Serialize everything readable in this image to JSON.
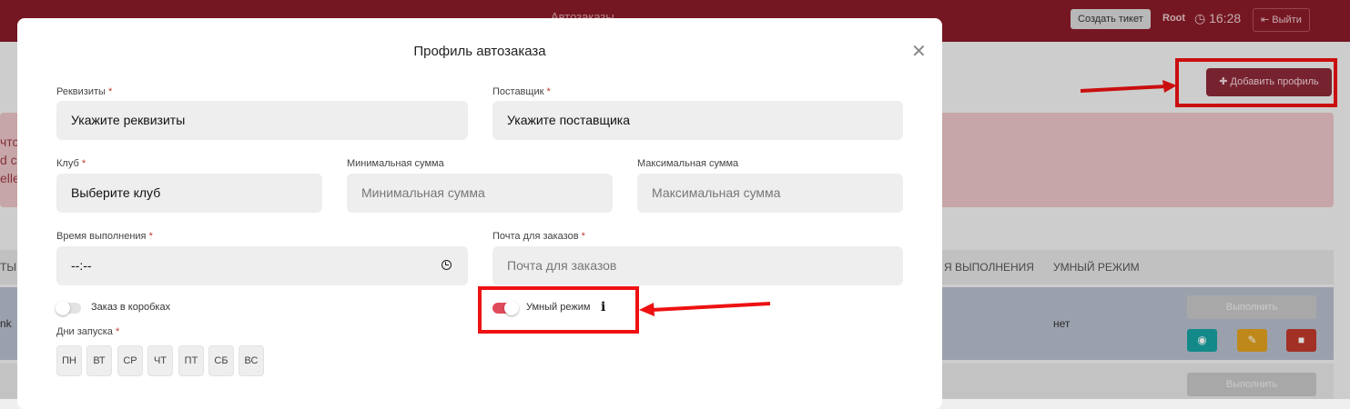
{
  "header": {
    "app_title": "Автозаказы",
    "create_ticket": "Создать тикет",
    "user": "Root",
    "time": "16:28",
    "exit": "Выйти"
  },
  "page": {
    "add_profile": "Добавить профиль",
    "alert_fragments": [
      "чтс",
      "d co",
      "elle"
    ],
    "table_headers": [
      "ТЫ",
      "Я ВЫПОЛНЕНИЯ",
      "УМНЫЙ РЕЖИМ"
    ],
    "row_prefix": "nk",
    "smart_mode_value": "нет",
    "execute": "Выполнить"
  },
  "modal": {
    "title": "Профиль автозаказа",
    "fields": {
      "requisites": {
        "label": "Реквизиты",
        "value": "Укажите реквизиты"
      },
      "supplier": {
        "label": "Поставщик",
        "value": "Укажите поставщика"
      },
      "club": {
        "label": "Клуб",
        "value": "Выберите клуб"
      },
      "min_sum": {
        "label": "Минимальная сумма",
        "placeholder": "Минимальная сумма"
      },
      "max_sum": {
        "label": "Максимальная сумма",
        "placeholder": "Максимальная сумма"
      },
      "exec_time": {
        "label": "Время выполнения",
        "value": "--:--"
      },
      "email": {
        "label": "Почта для заказов",
        "placeholder": "Почта для заказов"
      }
    },
    "boxes_toggle": {
      "label": "Заказ в коробках",
      "on": false
    },
    "smart_toggle": {
      "label": "Умный режим",
      "on": true
    },
    "days_label": "Дни запуска",
    "days": [
      "ПН",
      "ВТ",
      "СР",
      "ЧТ",
      "ПТ",
      "СБ",
      "ВС"
    ]
  },
  "colors": {
    "brand": "#8a1c28",
    "toggle_on": "#e04b5a",
    "highlight": "#ee1111"
  }
}
